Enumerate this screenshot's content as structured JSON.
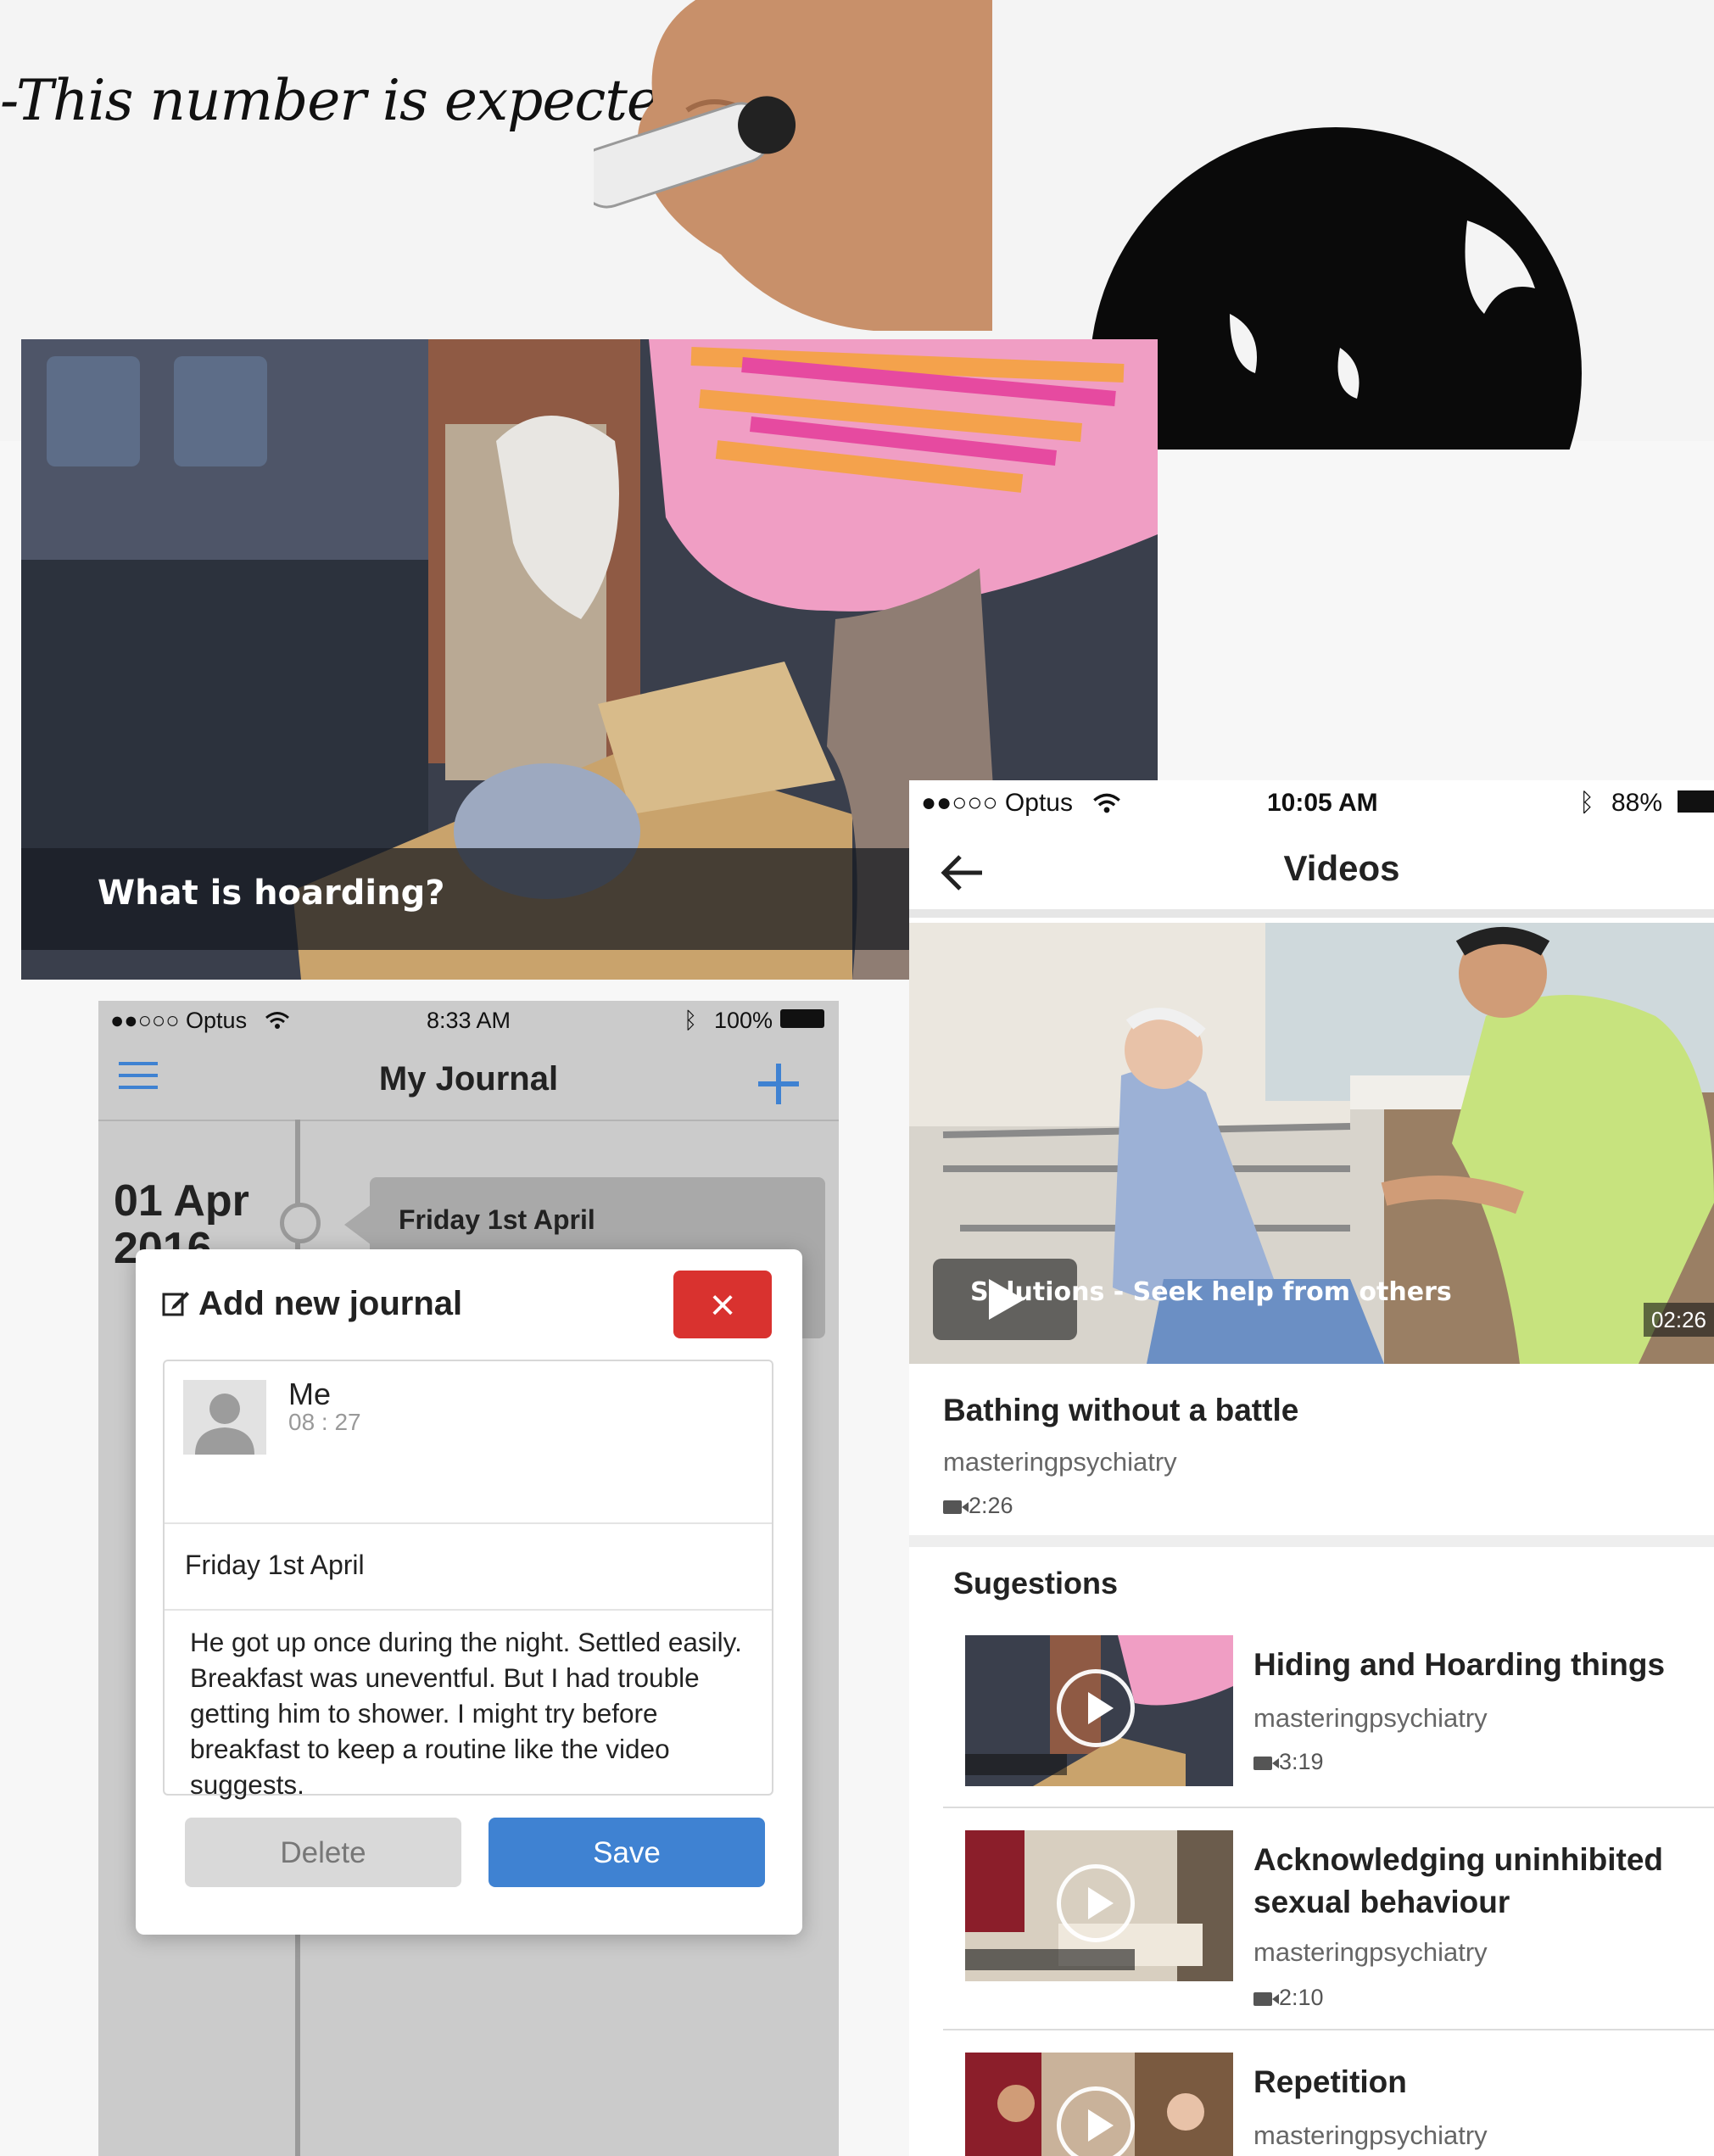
{
  "whiteboard": {
    "text": "-This number is expected"
  },
  "hoard_video": {
    "caption": "What is hoarding?"
  },
  "journal": {
    "status": {
      "carrier": "●●○○○ Optus",
      "time": "8:33 AM",
      "battery": "100%"
    },
    "title": "My Journal",
    "menu_icon": "hamburger-icon",
    "add_icon": "plus-icon",
    "timeline": {
      "date_line1": "01 Apr",
      "date_line2": "2016",
      "card_title": "Friday 1st April"
    },
    "modal": {
      "title": "Add new journal",
      "title_icon": "edit-icon",
      "close_label": "×",
      "author": "Me",
      "time": "08 : 27",
      "entry_title": "Friday 1st April",
      "entry_text": "He got up once during the night. Settled easily. Breakfast was uneventful. But I had trouble getting him to shower. I might try before breakfast to keep a routine like the video suggests.",
      "delete_label": "Delete",
      "save_label": "Save"
    }
  },
  "videos": {
    "status": {
      "carrier": "●●○○○ Optus",
      "time": "10:05 AM",
      "battery": "88%"
    },
    "title": "Videos",
    "back_icon": "arrow-left-icon",
    "player": {
      "caption": "Solutions - Seek help from others",
      "duration": "02:26"
    },
    "main": {
      "title": "Bathing without a battle",
      "channel": "masteringpsychiatry",
      "duration": "2:26"
    },
    "suggestions_label": "Sugestions",
    "suggestions": [
      {
        "title": "Hiding and Hoarding things",
        "channel": "masteringpsychiatry",
        "duration": "3:19"
      },
      {
        "title": "Acknowledging uninhibited sexual behaviour",
        "channel": "masteringpsychiatry",
        "duration": "2:10"
      },
      {
        "title": "Repetition",
        "channel": "masteringpsychiatry",
        "duration": ""
      }
    ]
  },
  "colors": {
    "save": "#3f82d2",
    "close": "#d9322f",
    "accent_blue": "#3f82d2"
  }
}
